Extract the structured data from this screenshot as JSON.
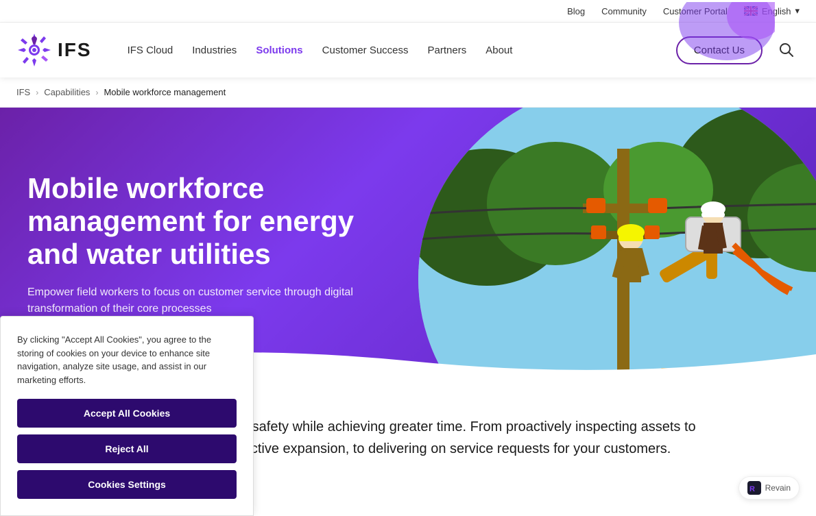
{
  "topbar": {
    "blog_label": "Blog",
    "community_label": "Community",
    "customer_portal_label": "Customer Portal",
    "language_label": "English",
    "chevron": "▾"
  },
  "nav": {
    "logo_text": "IFS",
    "links": [
      {
        "label": "IFS Cloud",
        "active": false
      },
      {
        "label": "Industries",
        "active": false
      },
      {
        "label": "Solutions",
        "active": true
      },
      {
        "label": "Customer Success",
        "active": false
      },
      {
        "label": "Partners",
        "active": false
      },
      {
        "label": "About",
        "active": false
      }
    ],
    "contact_label": "Contact Us"
  },
  "breadcrumb": {
    "ifs_label": "IFS",
    "capabilities_label": "Capabilities",
    "current_label": "Mobile workforce management"
  },
  "hero": {
    "title": "Mobile workforce management for energy and water utilities",
    "subtitle": "Empower field workers to focus on customer service through digital transformation of their core processes"
  },
  "content": {
    "text": "orker and community safety while achieving greater time. From proactively inspecting assets to ensure y and effective expansion, to delivering on service requests for your customers."
  },
  "cookie": {
    "description": "By clicking \"Accept All Cookies\", you agree to the storing of cookies on your device to enhance site navigation, analyze site usage, and assist in our marketing efforts.",
    "accept_label": "Accept All Cookies",
    "reject_label": "Reject All",
    "settings_label": "Cookies Settings"
  },
  "revain": {
    "label": "Revain"
  }
}
